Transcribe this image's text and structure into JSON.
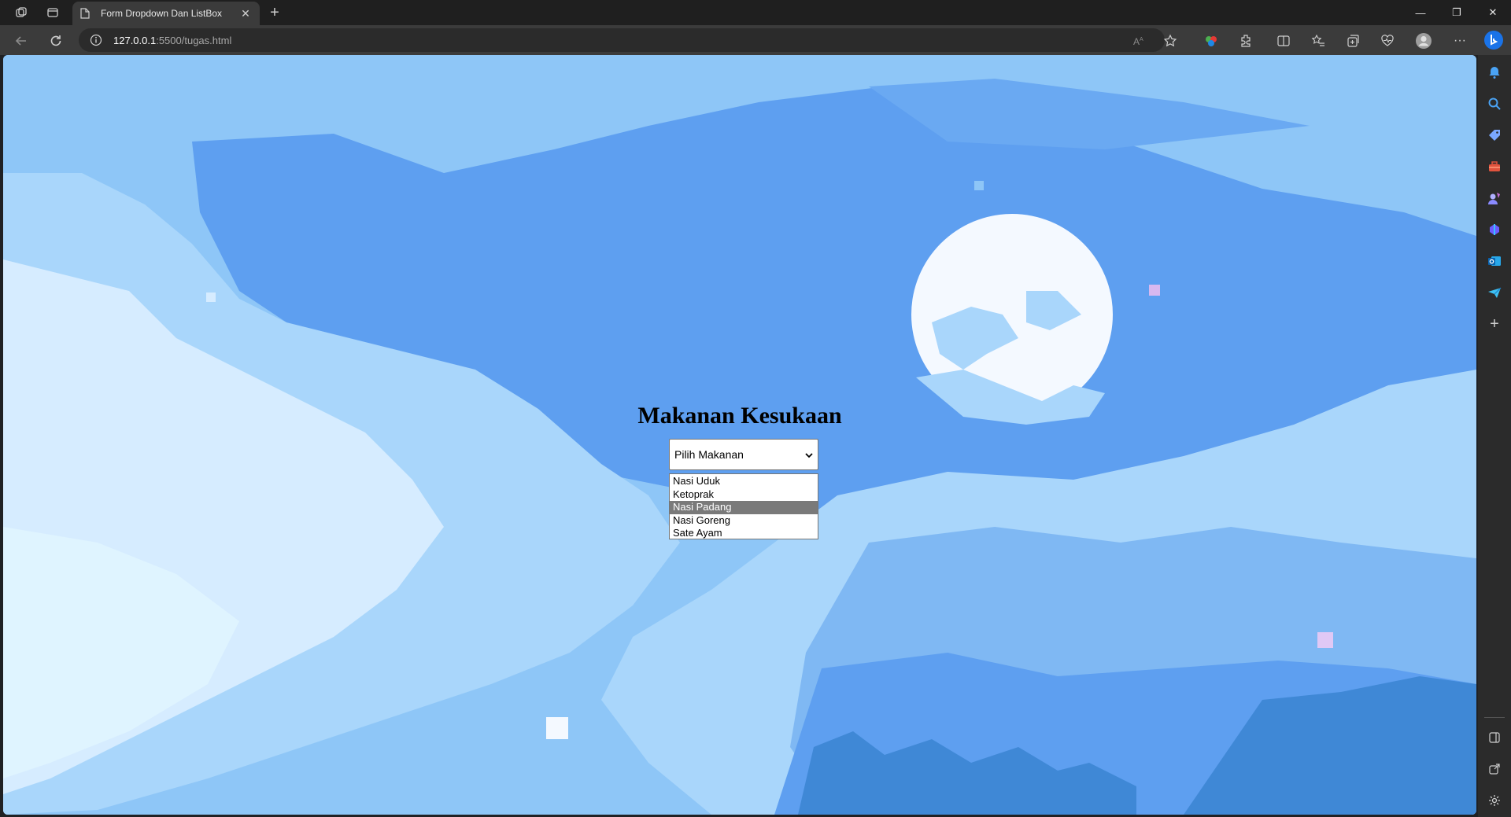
{
  "browser": {
    "tab_title": "Form Dropdown Dan ListBox",
    "url_host": "127.0.0.1",
    "url_path": ":5500/tugas.html"
  },
  "page": {
    "heading": "Makanan Kesukaan",
    "dropdown": {
      "selected_label": "Pilih Makanan"
    },
    "listbox": {
      "options": [
        {
          "label": "Nasi Uduk",
          "selected": false
        },
        {
          "label": "Ketoprak",
          "selected": false
        },
        {
          "label": "Nasi Padang",
          "selected": true
        },
        {
          "label": "Nasi Goreng",
          "selected": false
        },
        {
          "label": "Sate Ayam",
          "selected": false
        }
      ]
    }
  },
  "colors": {
    "sky": "#8ec6f7",
    "cloud_light": "#d6ecff",
    "cloud_mid": "#a9d6fb",
    "deep_blue": "#5e9ff0",
    "moon": "#f4f9ff",
    "selection": "#7a7a7a"
  }
}
